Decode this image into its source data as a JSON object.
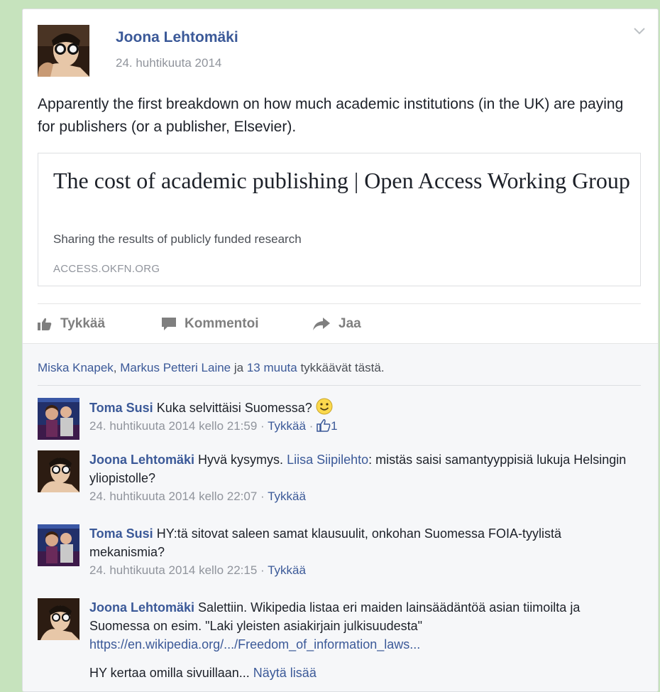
{
  "post": {
    "author": "Joona Lehtomäki",
    "date": "24. huhtikuuta 2014",
    "text": "Apparently the first breakdown on how much academic institutions (in the UK) are paying for publishers (or a publisher, Elsevier).",
    "link": {
      "title": "The cost of academic publishing | Open Access Working Group",
      "description": "Sharing the results of publicly funded research",
      "domain": "ACCESS.OKFN.ORG"
    }
  },
  "actions": {
    "like": "Tykkää",
    "comment": "Kommentoi",
    "share": "Jaa"
  },
  "likes": {
    "name1": "Miska Knapek",
    "sep1": ", ",
    "name2": "Markus Petteri Laine",
    "sep2": " ja ",
    "others": "13 muuta",
    "suffix": " tykkäävät tästä."
  },
  "comments": [
    {
      "author": "Toma Susi",
      "text": "Kuka selvittäisi Suomessa?",
      "meta": "24. huhtikuuta 2014 kello 21:59 · ",
      "like": "Tykkää",
      "sep": " · ",
      "like_count": "1"
    },
    {
      "author": "Joona Lehtomäki",
      "text": "Hyvä kysymys.",
      "mention": "Liisa Siipilehto",
      "text2": ": mistäs saisi samantyyppisiä lukuja Helsingin yliopistolle?",
      "meta": "24. huhtikuuta 2014 kello 22:07 · ",
      "like": "Tykkää"
    },
    {
      "author": "Toma Susi",
      "text": "HY:tä sitovat saleen samat klausuulit, onkohan Suomessa FOIA-tyylistä mekanismia?",
      "meta": "24. huhtikuuta 2014 kello 22:15 · ",
      "like": "Tykkää"
    },
    {
      "author": "Joona Lehtomäki",
      "text": "Salettiin. Wikipedia listaa eri maiden lainsäädäntöä asian tiimoilta ja Suomessa on esim. \"Laki yleisten asiakirjain julkisuudesta\"",
      "url": "https://en.wikipedia.org/.../Freedom_of_information_laws...",
      "more_text": "HY kertaa omilla sivuillaan...",
      "see_more": "Näytä lisää"
    }
  ],
  "colors": {
    "background": "#c6e3bd",
    "link": "#3b5998",
    "meta": "#90949c"
  }
}
